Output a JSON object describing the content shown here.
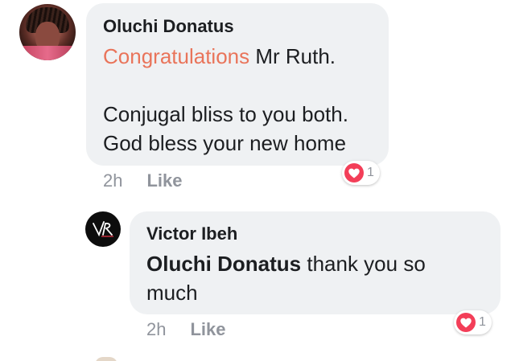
{
  "comments": [
    {
      "author": "Oluchi Donatus",
      "mention": "Congratulations",
      "line1_rest": " Mr Ruth.",
      "line2": "Conjugal bliss to you both.",
      "line3": "God bless your new home",
      "time": "2h",
      "like_label": "Like",
      "reaction_count": "1",
      "reaction_icon": "heart-icon",
      "accent_color": "#e9745a"
    },
    {
      "author": "Victor Ibeh",
      "mention": "Oluchi Donatus",
      "line1_rest": " thank you so",
      "line2": "much",
      "time": "2h",
      "like_label": "Like",
      "reaction_count": "1",
      "reaction_icon": "heart-icon"
    }
  ],
  "colors": {
    "bubble_bg": "#eff1f3",
    "meta_text": "#90949c",
    "heart_red": "#f33e58"
  }
}
